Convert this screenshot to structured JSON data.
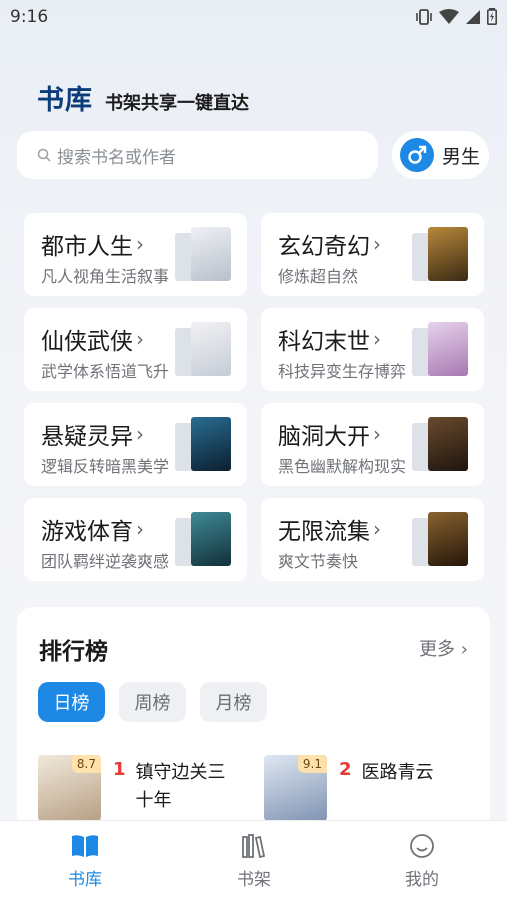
{
  "status_bar": {
    "time": "9:16"
  },
  "header": {
    "title": "书库",
    "subtitle": "书架共享一键直达"
  },
  "search": {
    "placeholder": "搜索书名或作者"
  },
  "gender": {
    "label": "男生"
  },
  "categories": [
    {
      "name": "都市人生",
      "desc": "凡人视角生活叙事",
      "cover_color": "#d9dde6"
    },
    {
      "name": "玄幻奇幻",
      "desc": "修炼超自然",
      "cover_color": "#5c4a2a"
    },
    {
      "name": "仙侠武侠",
      "desc": "武学体系悟道飞升",
      "cover_color": "#dfe3ea"
    },
    {
      "name": "科幻末世",
      "desc": "科技异变生存博弈",
      "cover_color": "#caa9cc"
    },
    {
      "name": "悬疑灵异",
      "desc": "逻辑反转暗黑美学",
      "cover_color": "#143c5a"
    },
    {
      "name": "脑洞大开",
      "desc": "黑色幽默解构现实",
      "cover_color": "#3a2a1c"
    },
    {
      "name": "游戏体育",
      "desc": "团队羁绊逆袭爽感",
      "cover_color": "#1f4d5a"
    },
    {
      "name": "无限流集",
      "desc": "爽文节奏快",
      "cover_color": "#3c2a18"
    }
  ],
  "ranking": {
    "title": "排行榜",
    "more": "更多",
    "tabs": [
      "日榜",
      "周榜",
      "月榜"
    ],
    "active_tab": "日榜",
    "books": [
      {
        "rank": "1",
        "title": "镇守边关三十年",
        "score": "8.7",
        "cover_color": "#e8dccc"
      },
      {
        "rank": "2",
        "title": "医路青云",
        "score": "9.1",
        "cover_color": "#b6c4d8"
      }
    ]
  },
  "nav": {
    "items": [
      "书库",
      "书架",
      "我的"
    ],
    "active": "书库"
  },
  "colors": {
    "accent": "#1e88e5",
    "title_dark": "#0d3c7a",
    "rank_red": "#e53935"
  }
}
